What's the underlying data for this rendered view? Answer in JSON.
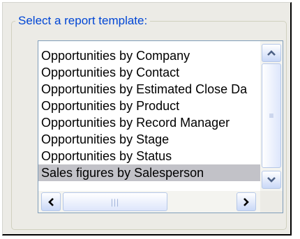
{
  "group": {
    "title": "Select a report template:"
  },
  "list": {
    "items": [
      "Opportunities by Company",
      "Opportunities by Contact",
      "Opportunities by Estimated Close Da",
      "Opportunities by Product",
      "Opportunities by Record Manager",
      "Opportunities by Stage",
      "Opportunities by Status",
      "Sales figures by Salesperson"
    ],
    "selected_index": 7
  },
  "icons": {
    "scroll_up": "chevron-up-icon",
    "scroll_down": "chevron-down-icon",
    "scroll_left": "chevron-left-icon",
    "scroll_right": "chevron-right-icon"
  },
  "colors": {
    "legend": "#0046d5",
    "selection": "#c2c2c8",
    "list_border": "#7f9db9"
  }
}
